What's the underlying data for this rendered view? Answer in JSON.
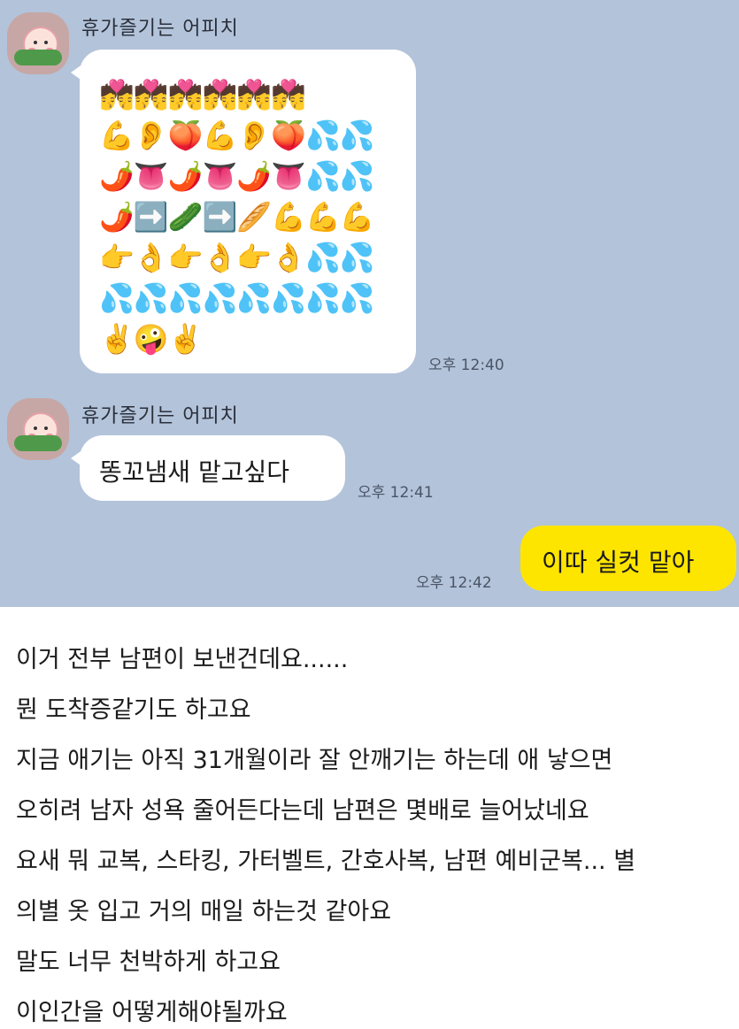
{
  "chat": {
    "messages": [
      {
        "sender": "휴가즐기는 어피치",
        "emoji_rows": [
          "💏💏💏💏💏💏",
          "💪👂🍑💪👂🍑💦💦",
          "🌶️👅🌶️👅🌶️👅💦💦",
          "🌶️➡️🥒➡️🥖💪💪💪",
          "👉👌👉👌👉👌💦💦",
          "💦💦💦💦💦💦💦💦",
          "✌️🤪✌️"
        ],
        "time": "오후 12:40"
      },
      {
        "sender": "휴가즐기는 어피치",
        "text": "똥꼬냄새 맡고싶다",
        "time": "오후 12:41"
      },
      {
        "text": "이따 실컷 맡아",
        "time": "오후 12:42"
      }
    ]
  },
  "article": {
    "lines": [
      "이거 전부 남편이 보낸건데요......",
      "뭔 도착증같기도 하고요",
      "지금 애기는 아직 31개월이라 잘 안깨기는 하는데 애 낳으면",
      "오히려 남자 성욕 줄어든다는데 남편은 몇배로 늘어났네요",
      "요새 뭐 교복, 스타킹, 가터벨트, 간호사복, 남편 예비군복... 별",
      "의별 옷 입고 거의 매일 하는것 같아요",
      "말도 너무 천박하게 하고요",
      "이인간을 어떻게해야될까요"
    ]
  },
  "colors": {
    "chat_background": "#b3c3da",
    "my_bubble": "#fee500",
    "other_bubble": "#ffffff"
  }
}
